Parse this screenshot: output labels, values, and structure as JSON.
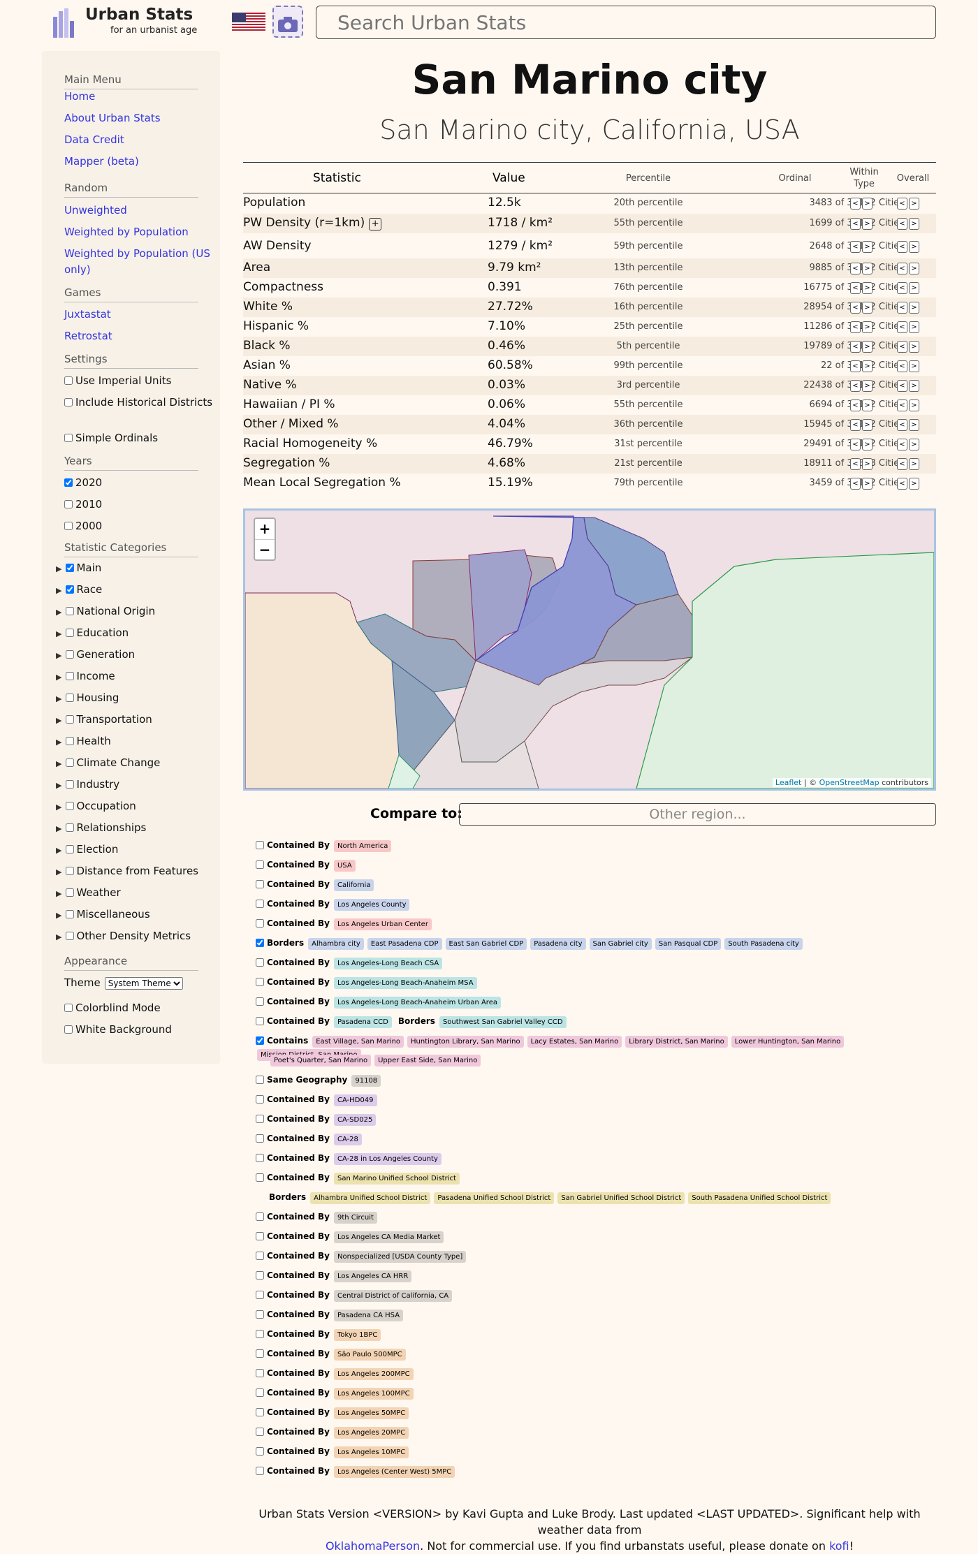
{
  "header": {
    "logo_title": "Urban Stats",
    "logo_subtitle": "for an urbanist age",
    "search_placeholder": "Search Urban Stats"
  },
  "sidebar": {
    "main_menu": "Main Menu",
    "main_links": [
      "Home",
      "About Urban Stats",
      "Data Credit",
      "Mapper (beta)"
    ],
    "random": "Random",
    "random_links": [
      "Unweighted",
      "Weighted by Population",
      "Weighted by Population (US only)"
    ],
    "games": "Games",
    "game_links": [
      "Juxtastat",
      "Retrostat"
    ],
    "settings": "Settings",
    "settings_opts": [
      "Use Imperial Units",
      "Include Historical Districts",
      "Simple Ordinals"
    ],
    "years": "Years",
    "year_opts": [
      {
        "label": "2020",
        "checked": true
      },
      {
        "label": "2010",
        "checked": false
      },
      {
        "label": "2000",
        "checked": false
      }
    ],
    "categories_title": "Statistic Categories",
    "categories": [
      {
        "label": "Main",
        "checked": true
      },
      {
        "label": "Race",
        "checked": true
      },
      {
        "label": "National Origin",
        "checked": false
      },
      {
        "label": "Education",
        "checked": false
      },
      {
        "label": "Generation",
        "checked": false
      },
      {
        "label": "Income",
        "checked": false
      },
      {
        "label": "Housing",
        "checked": false
      },
      {
        "label": "Transportation",
        "checked": false
      },
      {
        "label": "Health",
        "checked": false
      },
      {
        "label": "Climate Change",
        "checked": false
      },
      {
        "label": "Industry",
        "checked": false
      },
      {
        "label": "Occupation",
        "checked": false
      },
      {
        "label": "Relationships",
        "checked": false
      },
      {
        "label": "Election",
        "checked": false
      },
      {
        "label": "Distance from Features",
        "checked": false
      },
      {
        "label": "Weather",
        "checked": false
      },
      {
        "label": "Miscellaneous",
        "checked": false
      },
      {
        "label": "Other Density Metrics",
        "checked": false
      }
    ],
    "appearance": "Appearance",
    "theme_label": "Theme",
    "theme_value": "System Theme",
    "appearance_opts": [
      "Colorblind Mode",
      "White Background"
    ]
  },
  "page": {
    "title": "San Marino city",
    "subtitle": "San Marino city, California, USA"
  },
  "table": {
    "headers": {
      "statistic": "Statistic",
      "value": "Value",
      "percentile": "Percentile",
      "ordinal": "Ordinal",
      "within": "Within Type",
      "overall": "Overall"
    },
    "rows": [
      {
        "name": "Population",
        "value": "12.5k",
        "pct": "20th percentile",
        "ord": "3483 of 32132 Cities"
      },
      {
        "name": "PW Density (r=1km)",
        "value": "1718 / km²",
        "pct": "55th percentile",
        "ord": "1699 of 32132 Cities",
        "extra": "+"
      },
      {
        "name": "AW Density",
        "value": "1279 / km²",
        "pct": "59th percentile",
        "ord": "2648 of 32132 Cities"
      },
      {
        "name": "Area",
        "value": "9.79 km²",
        "pct": "13th percentile",
        "ord": "9885 of 32132 Cities"
      },
      {
        "name": "Compactness",
        "value": "0.391",
        "pct": "76th percentile",
        "ord": "16775 of 32132 Cities"
      },
      {
        "name": "White %",
        "value": "27.72%",
        "pct": "16th percentile",
        "ord": "28954 of 32132 Cities"
      },
      {
        "name": "Hispanic %",
        "value": "7.10%",
        "pct": "25th percentile",
        "ord": "11286 of 32132 Cities"
      },
      {
        "name": "Black %",
        "value": "0.46%",
        "pct": "5th percentile",
        "ord": "19789 of 32132 Cities"
      },
      {
        "name": "Asian %",
        "value": "60.58%",
        "pct": "99th percentile",
        "ord": "22 of 32132 Cities"
      },
      {
        "name": "Native %",
        "value": "0.03%",
        "pct": "3rd percentile",
        "ord": "22438 of 32132 Cities"
      },
      {
        "name": "Hawaiian / PI %",
        "value": "0.06%",
        "pct": "55th percentile",
        "ord": "6694 of 32132 Cities"
      },
      {
        "name": "Other / Mixed %",
        "value": "4.04%",
        "pct": "36th percentile",
        "ord": "15945 of 32132 Cities"
      },
      {
        "name": "Racial Homogeneity %",
        "value": "46.79%",
        "pct": "31st percentile",
        "ord": "29491 of 32132 Cities"
      },
      {
        "name": "Segregation %",
        "value": "4.68%",
        "pct": "21st percentile",
        "ord": "18911 of 31878 Cities"
      },
      {
        "name": "Mean Local Segregation %",
        "value": "15.19%",
        "pct": "79th percentile",
        "ord": "3459 of 32132 Cities"
      }
    ],
    "arrow_left": "<",
    "arrow_right": ">"
  },
  "map": {
    "zoom_in": "+",
    "zoom_out": "−",
    "attribution_leaflet": "Leaflet",
    "attribution_sep": " | © ",
    "attribution_osm": "OpenStreetMap",
    "attribution_tail": " contributors"
  },
  "compare": {
    "label": "Compare to:",
    "placeholder": "Other region..."
  },
  "colors": {
    "red": "#f8c8c8",
    "blue": "#c8d4ec",
    "teal": "#bce4e4",
    "pink": "#f0c8dc",
    "purple": "#dccbea",
    "yellow": "#ece2b0",
    "gray": "#d8d2cc",
    "orange": "#f2d4b4"
  },
  "relationships": [
    {
      "checked": false,
      "groups": [
        {
          "kind": "Contained By",
          "tags": [
            "North America"
          ],
          "color": "red"
        }
      ]
    },
    {
      "checked": false,
      "groups": [
        {
          "kind": "Contained By",
          "tags": [
            "USA"
          ],
          "color": "red"
        }
      ]
    },
    {
      "checked": false,
      "groups": [
        {
          "kind": "Contained By",
          "tags": [
            "California"
          ],
          "color": "blue"
        }
      ]
    },
    {
      "checked": false,
      "groups": [
        {
          "kind": "Contained By",
          "tags": [
            "Los Angeles County"
          ],
          "color": "blue"
        }
      ]
    },
    {
      "checked": false,
      "groups": [
        {
          "kind": "Contained By",
          "tags": [
            "Los Angeles Urban Center"
          ],
          "color": "red"
        }
      ]
    },
    {
      "checked": true,
      "groups": [
        {
          "kind": "Borders",
          "tags": [
            "Alhambra city",
            "East Pasadena CDP",
            "East San Gabriel CDP",
            "Pasadena city",
            "San Gabriel city",
            "San Pasqual CDP",
            "South Pasadena city"
          ],
          "color": "blue"
        }
      ]
    },
    {
      "checked": false,
      "groups": [
        {
          "kind": "Contained By",
          "tags": [
            "Los Angeles-Long Beach CSA"
          ],
          "color": "teal"
        }
      ]
    },
    {
      "checked": false,
      "groups": [
        {
          "kind": "Contained By",
          "tags": [
            "Los Angeles-Long Beach-Anaheim MSA"
          ],
          "color": "teal"
        }
      ]
    },
    {
      "checked": false,
      "groups": [
        {
          "kind": "Contained By",
          "tags": [
            "Los Angeles-Long Beach-Anaheim Urban Area"
          ],
          "color": "teal"
        }
      ]
    },
    {
      "checked": false,
      "groups": [
        {
          "kind": "Contained By",
          "tags": [
            "Pasadena CCD"
          ],
          "color": "teal"
        },
        {
          "kind": "Borders",
          "tags": [
            "Southwest San Gabriel Valley CCD"
          ],
          "color": "teal"
        }
      ]
    },
    {
      "checked": true,
      "groups": [
        {
          "kind": "Contains",
          "tags": [
            "East Village, San Marino",
            "Huntington Library, San Marino",
            "Lacy Estates, San Marino",
            "Library District, San Marino",
            "Lower Huntington, San Marino",
            "Mission District, San Marino",
            "Poet's Quarter, San Marino",
            "Upper East Side, San Marino"
          ],
          "color": "pink"
        }
      ]
    },
    {
      "checked": false,
      "groups": [
        {
          "kind": "Same Geography",
          "tags": [
            "91108"
          ],
          "color": "gray"
        }
      ]
    },
    {
      "checked": false,
      "groups": [
        {
          "kind": "Contained By",
          "tags": [
            "CA-HD049"
          ],
          "color": "purple"
        }
      ]
    },
    {
      "checked": false,
      "groups": [
        {
          "kind": "Contained By",
          "tags": [
            "CA-SD025"
          ],
          "color": "purple"
        }
      ]
    },
    {
      "checked": false,
      "groups": [
        {
          "kind": "Contained By",
          "tags": [
            "CA-28"
          ],
          "color": "purple"
        }
      ]
    },
    {
      "checked": false,
      "groups": [
        {
          "kind": "Contained By",
          "tags": [
            "CA-28 in Los Angeles County"
          ],
          "color": "purple"
        }
      ]
    },
    {
      "checked": false,
      "groups": [
        {
          "kind": "Contained By",
          "tags": [
            "San Marino Unified School District"
          ],
          "color": "yellow"
        },
        {
          "kind": "Borders",
          "tags": [
            "Alhambra Unified School District",
            "Pasadena Unified School District",
            "San Gabriel Unified School District",
            "South Pasadena Unified School District"
          ],
          "color": "yellow"
        }
      ]
    },
    {
      "checked": false,
      "groups": [
        {
          "kind": "Contained By",
          "tags": [
            "9th Circuit"
          ],
          "color": "gray"
        }
      ]
    },
    {
      "checked": false,
      "groups": [
        {
          "kind": "Contained By",
          "tags": [
            "Los Angeles CA Media Market"
          ],
          "color": "gray"
        }
      ]
    },
    {
      "checked": false,
      "groups": [
        {
          "kind": "Contained By",
          "tags": [
            "Nonspecialized [USDA County Type]"
          ],
          "color": "gray"
        }
      ]
    },
    {
      "checked": false,
      "groups": [
        {
          "kind": "Contained By",
          "tags": [
            "Los Angeles CA HRR"
          ],
          "color": "gray"
        }
      ]
    },
    {
      "checked": false,
      "groups": [
        {
          "kind": "Contained By",
          "tags": [
            "Central District of California, CA"
          ],
          "color": "gray"
        }
      ]
    },
    {
      "checked": false,
      "groups": [
        {
          "kind": "Contained By",
          "tags": [
            "Pasadena CA HSA"
          ],
          "color": "gray"
        }
      ]
    },
    {
      "checked": false,
      "groups": [
        {
          "kind": "Contained By",
          "tags": [
            "Tokyo 1BPC"
          ],
          "color": "orange"
        }
      ]
    },
    {
      "checked": false,
      "groups": [
        {
          "kind": "Contained By",
          "tags": [
            "São Paulo 500MPC"
          ],
          "color": "orange"
        }
      ]
    },
    {
      "checked": false,
      "groups": [
        {
          "kind": "Contained By",
          "tags": [
            "Los Angeles 200MPC"
          ],
          "color": "orange"
        }
      ]
    },
    {
      "checked": false,
      "groups": [
        {
          "kind": "Contained By",
          "tags": [
            "Los Angeles 100MPC"
          ],
          "color": "orange"
        }
      ]
    },
    {
      "checked": false,
      "groups": [
        {
          "kind": "Contained By",
          "tags": [
            "Los Angeles 50MPC"
          ],
          "color": "orange"
        }
      ]
    },
    {
      "checked": false,
      "groups": [
        {
          "kind": "Contained By",
          "tags": [
            "Los Angeles 20MPC"
          ],
          "color": "orange"
        }
      ]
    },
    {
      "checked": false,
      "groups": [
        {
          "kind": "Contained By",
          "tags": [
            "Los Angeles 10MPC"
          ],
          "color": "orange"
        }
      ]
    },
    {
      "checked": false,
      "groups": [
        {
          "kind": "Contained By",
          "tags": [
            "Los Angeles (Center West) 5MPC"
          ],
          "color": "orange"
        }
      ]
    }
  ],
  "footer": {
    "line1": "Urban Stats Version <VERSION> by Kavi Gupta and Luke Brody. Last updated <LAST UPDATED>. Significant help with weather data from",
    "link1": "OklahomaPerson",
    "mid": ". Not for commercial use. If you find urbanstats useful, please donate on ",
    "link2": "kofi",
    "end": "!"
  }
}
